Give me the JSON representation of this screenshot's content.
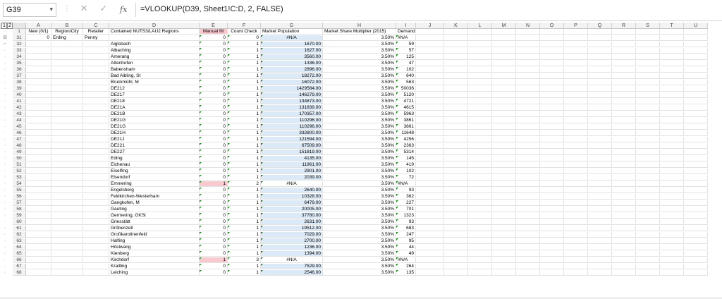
{
  "namebox": "G39",
  "formula": "=VLOOKUP(D39, Sheet1!C:D, 2, FALSE)",
  "fx": "fx",
  "outline_levels": [
    "1",
    "2"
  ],
  "columns": [
    "A",
    "B",
    "C",
    "D",
    "E",
    "F",
    "G",
    "H",
    "I",
    "J",
    "K",
    "L",
    "M",
    "N",
    "O",
    "P",
    "Q",
    "R",
    "S",
    "T",
    "U"
  ],
  "header_row": {
    "num": "1",
    "A": "New (0/1)",
    "B": "Region/City",
    "C": "Retailer",
    "D": "Contained NUTS3/LAU2 Regions",
    "E": "Manual fill",
    "F": "Count Check",
    "G": "Market Population",
    "H": "Market Share Multiplier (2015)",
    "I": "Demand"
  },
  "rows": [
    {
      "n": "31",
      "a": "0",
      "b": "Erding",
      "c": "Penny",
      "d": "",
      "e": "0",
      "f": "0",
      "g": "#N/A",
      "h": "3.50%",
      "i": "#N/A",
      "ge": true
    },
    {
      "n": "32",
      "d": "Aiglsbach",
      "e": "0",
      "f": "1",
      "g": "1670.00",
      "h": "3.50%",
      "i": "59"
    },
    {
      "n": "33",
      "d": "Albaching",
      "e": "0",
      "f": "1",
      "g": "1627.00",
      "h": "3.50%",
      "i": "57"
    },
    {
      "n": "34",
      "d": "Amerang",
      "e": "0",
      "f": "1",
      "g": "3560.00",
      "h": "3.50%",
      "i": "125"
    },
    {
      "n": "35",
      "d": "Attenhofen",
      "e": "0",
      "f": "1",
      "g": "1336.00",
      "h": "3.50%",
      "i": "47"
    },
    {
      "n": "36",
      "d": "Babensham",
      "e": "0",
      "f": "1",
      "g": "2896.00",
      "h": "3.50%",
      "i": "102"
    },
    {
      "n": "37",
      "d": "Bad Aibling, St",
      "e": "0",
      "f": "1",
      "g": "18272.00",
      "h": "3.50%",
      "i": "640"
    },
    {
      "n": "38",
      "d": "Bruckmühl, M",
      "e": "0",
      "f": "1",
      "g": "16072.00",
      "h": "3.50%",
      "i": "563"
    },
    {
      "n": "39",
      "d": "DE212",
      "e": "0",
      "f": "1",
      "g": "1429584.00",
      "h": "3.50%",
      "i": "50036"
    },
    {
      "n": "40",
      "d": "DE217",
      "e": "0",
      "f": "1",
      "g": "146279.00",
      "h": "3.50%",
      "i": "5120"
    },
    {
      "n": "41",
      "d": "DE218",
      "e": "0",
      "f": "1",
      "g": "134873.00",
      "h": "3.50%",
      "i": "4721"
    },
    {
      "n": "42",
      "d": "DE21A",
      "e": "0",
      "f": "1",
      "g": "131839.00",
      "h": "3.50%",
      "i": "4615"
    },
    {
      "n": "43",
      "d": "DE21B",
      "e": "0",
      "f": "1",
      "g": "170357.00",
      "h": "3.50%",
      "i": "5963"
    },
    {
      "n": "44",
      "d": "DE21G",
      "e": "0",
      "f": "1",
      "g": "110296.00",
      "h": "3.50%",
      "i": "3861"
    },
    {
      "n": "45",
      "d": "DE21G",
      "e": "0",
      "f": "1",
      "g": "110296.00",
      "h": "3.50%",
      "i": "3861"
    },
    {
      "n": "46",
      "d": "DE21H",
      "e": "0",
      "f": "1",
      "g": "332800.00",
      "h": "3.50%",
      "i": "11648"
    },
    {
      "n": "47",
      "d": "DE21J",
      "e": "0",
      "f": "1",
      "g": "121594.00",
      "h": "3.50%",
      "i": "4256"
    },
    {
      "n": "48",
      "d": "DE221",
      "e": "0",
      "f": "1",
      "g": "67509.00",
      "h": "3.50%",
      "i": "2363"
    },
    {
      "n": "49",
      "d": "DE227",
      "e": "0",
      "f": "1",
      "g": "151819.00",
      "h": "3.50%",
      "i": "5314"
    },
    {
      "n": "50",
      "d": "Eding",
      "e": "0",
      "f": "1",
      "g": "4135.00",
      "h": "3.50%",
      "i": "145"
    },
    {
      "n": "51",
      "d": "Eichenau",
      "e": "0",
      "f": "1",
      "g": "11961.00",
      "h": "3.50%",
      "i": "419"
    },
    {
      "n": "52",
      "d": "Eiselfing",
      "e": "0",
      "f": "1",
      "g": "2901.00",
      "h": "3.50%",
      "i": "102"
    },
    {
      "n": "53",
      "d": "Elsendorf",
      "e": "0",
      "f": "1",
      "g": "2039.00",
      "h": "3.50%",
      "i": "72"
    },
    {
      "n": "54",
      "d": "Emmering",
      "e": "1",
      "f": "2",
      "g": "#N/A",
      "h": "3.50%",
      "i": "#N/A",
      "pink": true,
      "gw": true
    },
    {
      "n": "55",
      "d": "Engelsberg",
      "e": "0",
      "f": "1",
      "g": "2640.00",
      "h": "3.50%",
      "i": "93"
    },
    {
      "n": "56",
      "d": "Feldkirchen-Westerham",
      "e": "0",
      "f": "1",
      "g": "10328.00",
      "h": "3.50%",
      "i": "362"
    },
    {
      "n": "57",
      "d": "Gangkofen, M",
      "e": "0",
      "f": "1",
      "g": "6479.00",
      "h": "3.50%",
      "i": "227"
    },
    {
      "n": "58",
      "d": "Gauting",
      "e": "0",
      "f": "1",
      "g": "20005.00",
      "h": "3.50%",
      "i": "701"
    },
    {
      "n": "59",
      "d": "Germering, GKSt",
      "e": "0",
      "f": "1",
      "g": "37780.00",
      "h": "3.50%",
      "i": "1323"
    },
    {
      "n": "60",
      "d": "Griesstätt",
      "e": "0",
      "f": "1",
      "g": "2631.00",
      "h": "3.50%",
      "i": "93"
    },
    {
      "n": "61",
      "d": "Gröbenzell",
      "e": "0",
      "f": "1",
      "g": "19512.00",
      "h": "3.50%",
      "i": "683"
    },
    {
      "n": "62",
      "d": "Großkarolinenfeld",
      "e": "0",
      "f": "1",
      "g": "7029.00",
      "h": "3.50%",
      "i": "247"
    },
    {
      "n": "63",
      "d": "Halfing",
      "e": "0",
      "f": "1",
      "g": "2700.00",
      "h": "3.50%",
      "i": "95"
    },
    {
      "n": "64",
      "d": "Höslwang",
      "e": "0",
      "f": "1",
      "g": "1236.00",
      "h": "3.50%",
      "i": "44"
    },
    {
      "n": "65",
      "d": "Kienberg",
      "e": "0",
      "f": "1",
      "g": "1394.00",
      "h": "3.50%",
      "i": "49"
    },
    {
      "n": "66",
      "d": "Kirchdorf",
      "e": "1",
      "f": "3",
      "g": "#N/A",
      "h": "3.50%",
      "i": "#N/A",
      "pink": true,
      "gw": true
    },
    {
      "n": "67",
      "d": "Krailling",
      "e": "0",
      "f": "1",
      "g": "7529.00",
      "h": "3.50%",
      "i": "264"
    },
    {
      "n": "68",
      "d": "Leiching",
      "e": "0",
      "f": "1",
      "g": "2546.00",
      "h": "3.50%",
      "i": "135"
    }
  ]
}
